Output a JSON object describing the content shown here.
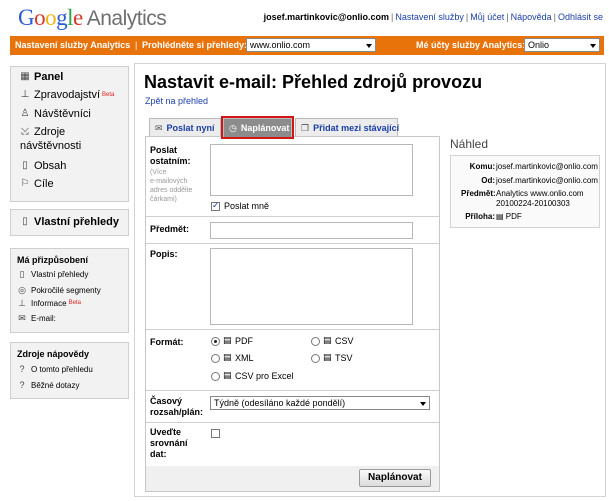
{
  "header": {
    "logo_google": "Google",
    "logo_analytics": "Analytics",
    "user_email": "josef.martinkovic@onlio.com",
    "links": [
      "Nastavení služby",
      "Můj účet",
      "Nápověda",
      "Odhlásit se"
    ]
  },
  "orangebar": {
    "settings_label": "Nastavení služby Analytics",
    "browse_label": "Prohlédněte si přehledy:",
    "browse_value": "www.onlio.com",
    "accounts_label": "Mé účty služby Analytics:",
    "accounts_value": "Onlio"
  },
  "sidebar": {
    "nav": [
      {
        "label": "Panel",
        "icon": "grid-icon"
      },
      {
        "label": "Zpravodajství",
        "icon": "chart-icon",
        "badge": "Beta"
      },
      {
        "label": "Návštěvníci",
        "icon": "person-icon"
      },
      {
        "label": "Zdroje",
        "label2": "návštěvnosti",
        "icon": "traffic-icon"
      },
      {
        "label": "Obsah",
        "icon": "page-icon"
      },
      {
        "label": "Cíle",
        "icon": "flag-icon"
      }
    ],
    "custom_reports": "Vlastní přehledy",
    "customizations": {
      "heading": "Má přizpůsobení",
      "items": [
        {
          "label": "Vlastní přehledy",
          "icon": "report-icon"
        },
        {
          "label": "Pokročilé segmenty",
          "icon": "segment-icon"
        },
        {
          "label": "Informace",
          "icon": "chart-icon",
          "badge": "Beta"
        },
        {
          "label": "E-mail:",
          "icon": "mail-icon"
        }
      ]
    },
    "help": {
      "heading": "Zdroje nápovědy",
      "items": [
        "O tomto přehledu",
        "Běžné dotazy"
      ]
    }
  },
  "main": {
    "title": "Nastavit e-mail: Přehled zdrojů provozu",
    "back_link": "Zpět na přehled",
    "tabs": [
      {
        "label": "Poslat nyní",
        "icon": "mail-icon"
      },
      {
        "label": "Naplánovat",
        "icon": "clock-icon"
      },
      {
        "label": "Přidat mezi stávající",
        "icon": "copy-icon"
      }
    ],
    "form": {
      "send_others_label1": "Poslat",
      "send_others_label2": "ostatním:",
      "send_others_hint": [
        "(Více",
        "e-mailových",
        "adres oddělte",
        "čárkami)"
      ],
      "send_me_label": "Poslat mně",
      "subject_label": "Předmět:",
      "desc_label": "Popis:",
      "format_label": "Formát:",
      "formats": [
        "PDF",
        "CSV",
        "XML",
        "TSV",
        "CSV pro Excel"
      ],
      "schedule_label1": "Časový",
      "schedule_label2": "rozsah/plán:",
      "schedule_value": "Týdně (odesíláno každé pondělí)",
      "compare_label": [
        "Uveďte",
        "srovnání",
        "dat:"
      ],
      "submit": "Naplánovat"
    }
  },
  "preview": {
    "title": "Náhled",
    "to_label": "Komu:",
    "to_value": "josef.martinkovic@onlio.com",
    "from_label": "Od:",
    "from_value": "josef.martinkovic@onlio.com",
    "subject_label": "Předmět:",
    "subject_value1": "Analytics www.onlio.com",
    "subject_value2": "20100224-20100303",
    "attachment_label": "Příloha:",
    "attachment_value": "PDF"
  }
}
